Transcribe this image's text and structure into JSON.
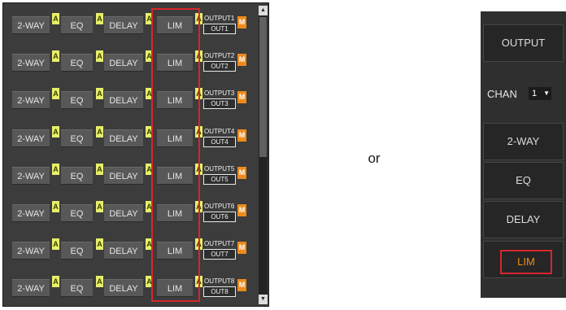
{
  "matrix": {
    "rows": [
      {
        "twoway": "2-WAY",
        "a": "A",
        "eq": "EQ",
        "delay": "DELAY",
        "lim": "LIM",
        "output_name": "OUTPUT1",
        "output_button": "OUT1",
        "mute": "M"
      },
      {
        "twoway": "2-WAY",
        "a": "A",
        "eq": "EQ",
        "delay": "DELAY",
        "lim": "LIM",
        "output_name": "OUTPUT2",
        "output_button": "OUT2",
        "mute": "M"
      },
      {
        "twoway": "2-WAY",
        "a": "A",
        "eq": "EQ",
        "delay": "DELAY",
        "lim": "LIM",
        "output_name": "OUTPUT3",
        "output_button": "OUT3",
        "mute": "M"
      },
      {
        "twoway": "2-WAY",
        "a": "A",
        "eq": "EQ",
        "delay": "DELAY",
        "lim": "LIM",
        "output_name": "OUTPUT4",
        "output_button": "OUT4",
        "mute": "M"
      },
      {
        "twoway": "2-WAY",
        "a": "A",
        "eq": "EQ",
        "delay": "DELAY",
        "lim": "LIM",
        "output_name": "OUTPUT5",
        "output_button": "OUT5",
        "mute": "M"
      },
      {
        "twoway": "2-WAY",
        "a": "A",
        "eq": "EQ",
        "delay": "DELAY",
        "lim": "LIM",
        "output_name": "OUTPUT6",
        "output_button": "OUT6",
        "mute": "M"
      },
      {
        "twoway": "2-WAY",
        "a": "A",
        "eq": "EQ",
        "delay": "DELAY",
        "lim": "LIM",
        "output_name": "OUTPUT7",
        "output_button": "OUT7",
        "mute": "M"
      },
      {
        "twoway": "2-WAY",
        "a": "A",
        "eq": "EQ",
        "delay": "DELAY",
        "lim": "LIM",
        "output_name": "OUTPUT8",
        "output_button": "OUT8",
        "mute": "M"
      }
    ],
    "scroll_up_icon": "triangle-up-icon",
    "scroll_down_icon": "triangle-down-icon",
    "highlight_color": "#d6262c"
  },
  "separator_text": "or",
  "vertical_panel": {
    "output_label": "OUTPUT",
    "chan_label": "CHAN",
    "chan_value": "1",
    "dropdown_icon": "triangle-down-icon",
    "twoway_label": "2-WAY",
    "eq_label": "EQ",
    "delay_label": "DELAY",
    "lim_label": "LIM",
    "lim_text_color": "#ee8a1c"
  },
  "colors": {
    "a_badge": "#e6ef6a",
    "m_badge": "#ee8a1c",
    "button_bg": "#585858",
    "panel_bg": "#3c3c3c"
  }
}
